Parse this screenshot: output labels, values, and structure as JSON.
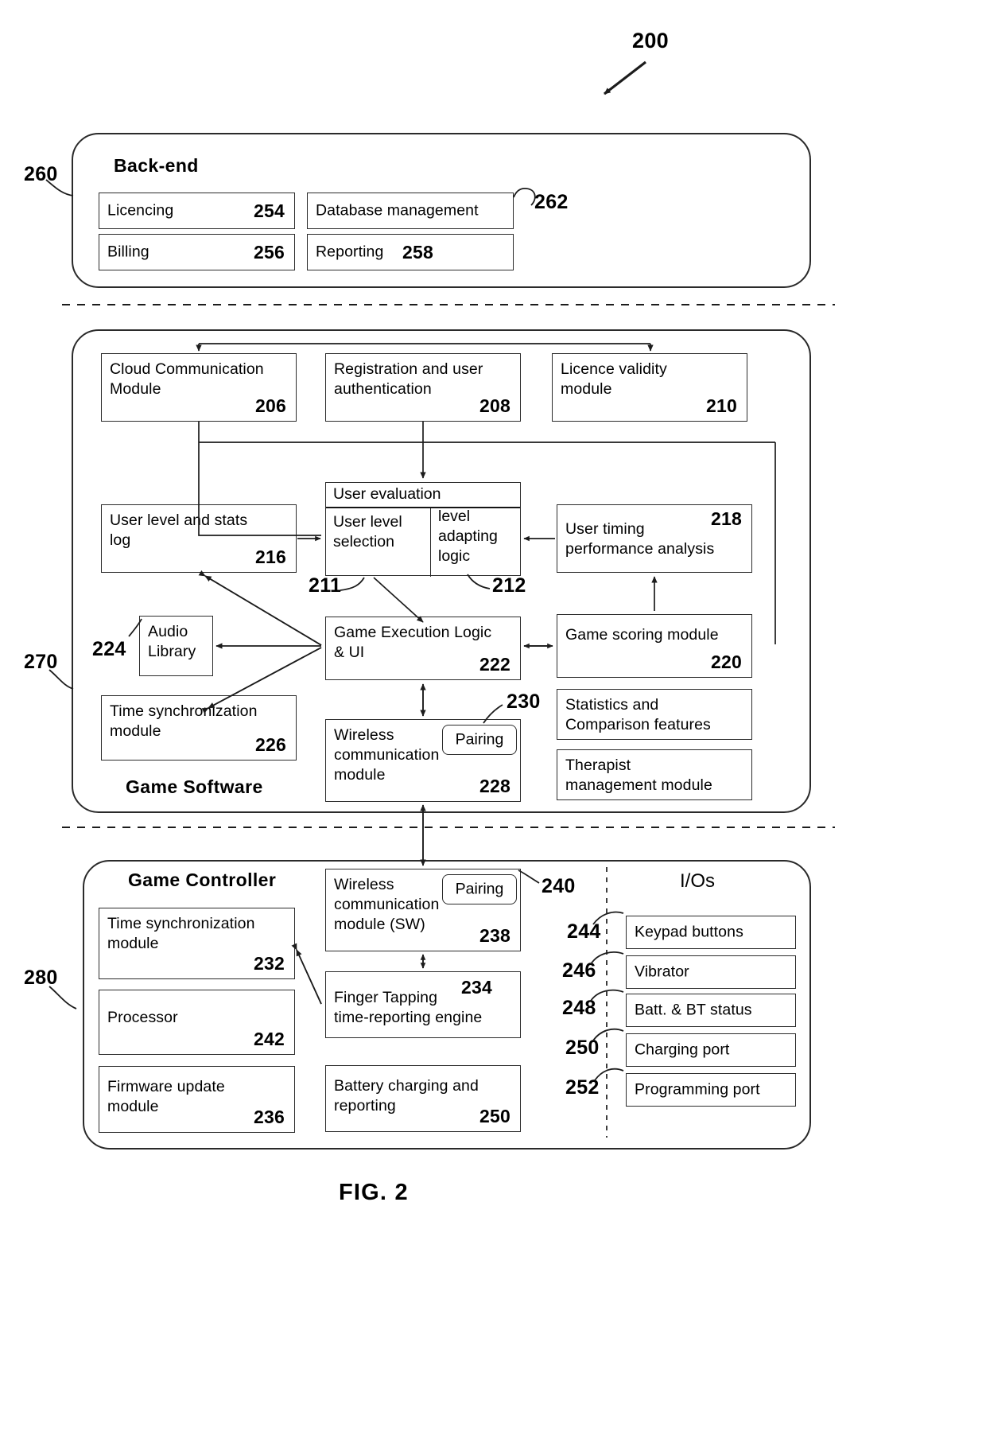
{
  "figure": {
    "label": "FIG. 2",
    "system_ref": "200"
  },
  "backend": {
    "ref": "260",
    "title": "Back-end",
    "database_ref": "262",
    "modules": [
      {
        "label": "Licencing",
        "num": "254"
      },
      {
        "label": "Billing",
        "num": "256"
      },
      {
        "label": "Database management",
        "num": ""
      },
      {
        "label": "Reporting",
        "num": "258"
      }
    ]
  },
  "game_software": {
    "ref": "270",
    "title": "Game Software",
    "modules": [
      {
        "label": "Cloud Communication\nModule",
        "num": "206"
      },
      {
        "label": "Registration and user\nauthentication",
        "num": "208"
      },
      {
        "label": "Licence validity\nmodule",
        "num": "210"
      },
      {
        "label": "User level and stats\nlog",
        "num": "216"
      },
      {
        "label": "User timing\nperformance analysis",
        "num": "218"
      },
      {
        "label": "Audio\nLibrary",
        "num": ""
      },
      {
        "label": "Game Execution Logic\n& UI",
        "num": "222"
      },
      {
        "label": "Game scoring module",
        "num": "220"
      },
      {
        "label": "Time synchronization\nmodule",
        "num": "226"
      },
      {
        "label": "Wireless\ncommunication\nmodule",
        "num": "228"
      },
      {
        "label": "Statistics and\nComparison features",
        "num": ""
      },
      {
        "label": "Therapist\nmanagement module",
        "num": ""
      }
    ],
    "user_evaluation": {
      "title": "User evaluation",
      "left_cell": "User level\nselection",
      "right_cell": "level\nadapting\nlogic",
      "left_ref": "211",
      "right_ref": "212"
    },
    "audio_library_ref": "224",
    "pairing_label": "Pairing",
    "pairing_ref": "230"
  },
  "game_controller": {
    "ref": "280",
    "title": "Game Controller",
    "modules": [
      {
        "label": "Time synchronization\nmodule",
        "num": "232"
      },
      {
        "label": "Processor",
        "num": "242"
      },
      {
        "label": "Firmware update\nmodule",
        "num": "236"
      },
      {
        "label": "Wireless\ncommunication\nmodule (SW)",
        "num": "238"
      },
      {
        "label": "Finger Tapping\ntime-reporting engine",
        "num": "234"
      },
      {
        "label": "Battery charging and\nreporting",
        "num": "250"
      }
    ],
    "pairing_label": "Pairing",
    "pairing_ref": "240",
    "ios": {
      "title": "I/Os",
      "items": [
        {
          "label": "Keypad buttons",
          "ref": "244"
        },
        {
          "label": "Vibrator",
          "ref": "246"
        },
        {
          "label": "Batt. & BT status",
          "ref": "248"
        },
        {
          "label": "Charging port",
          "ref": "250"
        },
        {
          "label": "Programming port",
          "ref": "252"
        }
      ]
    }
  }
}
